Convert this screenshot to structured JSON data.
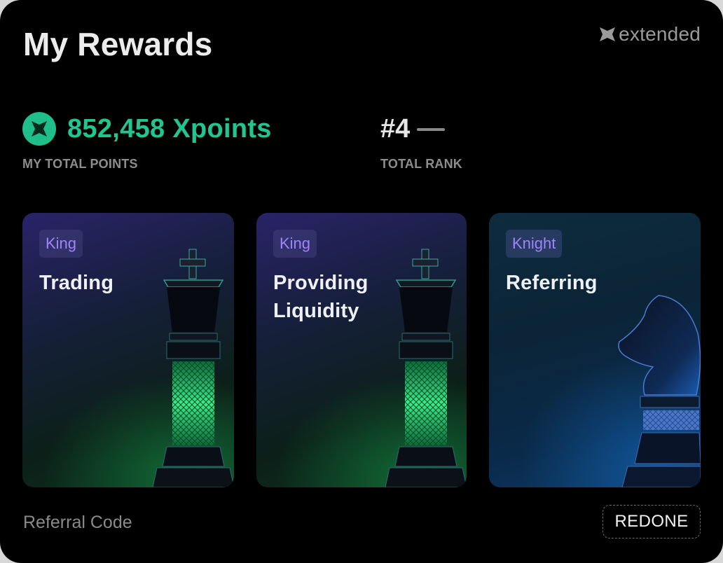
{
  "header": {
    "title": "My Rewards",
    "brand": "extended"
  },
  "stats": {
    "points_value": "852,458 Xpoints",
    "points_label": "MY TOTAL POINTS",
    "rank_value": "#4",
    "rank_label": "TOTAL RANK"
  },
  "tiles": [
    {
      "badge": "King",
      "name": "Trading",
      "piece": "king-chess-piece",
      "glow": "green"
    },
    {
      "badge": "King",
      "name": "Providing Liquidity",
      "piece": "king-chess-piece",
      "glow": "green"
    },
    {
      "badge": "Knight",
      "name": "Referring",
      "piece": "knight-chess-piece",
      "glow": "blue"
    }
  ],
  "referral": {
    "label": "Referral Code",
    "code": "REDONE"
  },
  "colors": {
    "accent": "#22c48f",
    "badge_text": "#9f83ff",
    "background": "#000000"
  }
}
